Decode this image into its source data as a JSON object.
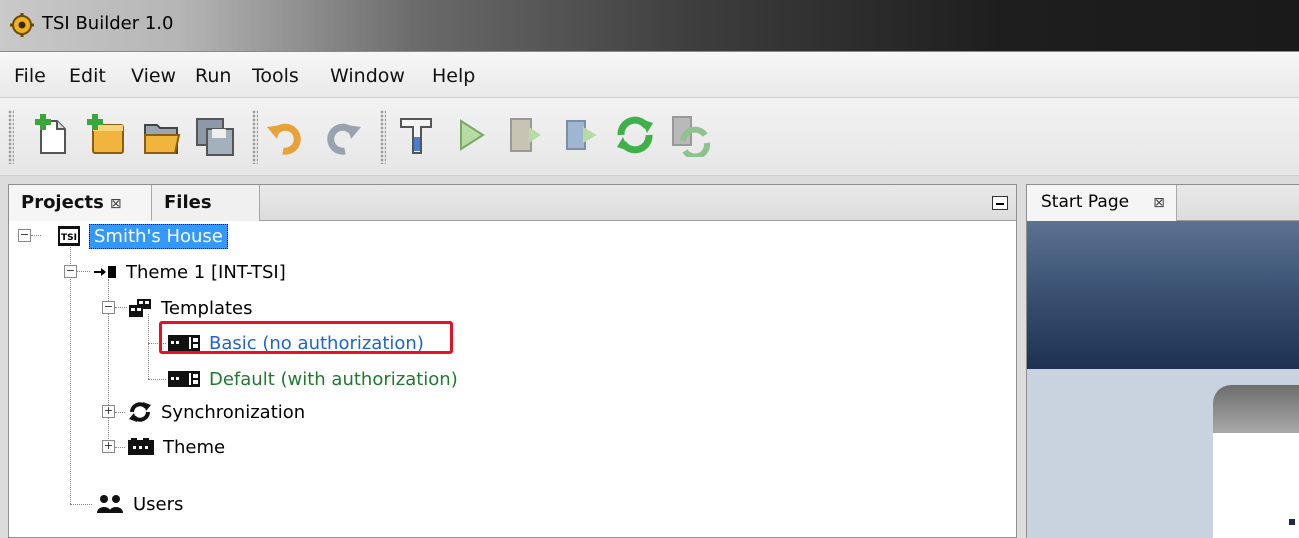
{
  "window": {
    "title": "TSI Builder 1.0"
  },
  "menu": [
    "File",
    "Edit",
    "View",
    "Run",
    "Tools",
    "Window",
    "Help"
  ],
  "toolbar": {
    "buttons": [
      {
        "name": "new-file-icon"
      },
      {
        "name": "new-project-icon"
      },
      {
        "name": "open-project-icon"
      },
      {
        "name": "save-all-icon"
      },
      {
        "name": "undo-icon"
      },
      {
        "name": "redo-icon"
      },
      {
        "name": "build-hammer-icon"
      },
      {
        "name": "run-icon"
      },
      {
        "name": "deploy-icon"
      },
      {
        "name": "synchronize-icon"
      },
      {
        "name": "synchronize-all-icon"
      }
    ]
  },
  "projects_panel": {
    "tabs": [
      "Projects",
      "Files"
    ],
    "close_glyph": "⊠"
  },
  "tree": {
    "project": "Smith's House",
    "project_badge": "TSI",
    "theme_node": "Theme 1 [INT-TSI]",
    "templates": "Templates",
    "template_basic": "Basic (no authorization)",
    "template_default": "Default (with authorization)",
    "synchronization": "Synchronization",
    "theme": "Theme",
    "users": "Users"
  },
  "editor": {
    "tab": "Start Page"
  },
  "colors": {
    "selection": "#3399ff",
    "highlight": "#e81123",
    "basic_text": "#1f63d6",
    "default_text": "#1e7b2e"
  }
}
